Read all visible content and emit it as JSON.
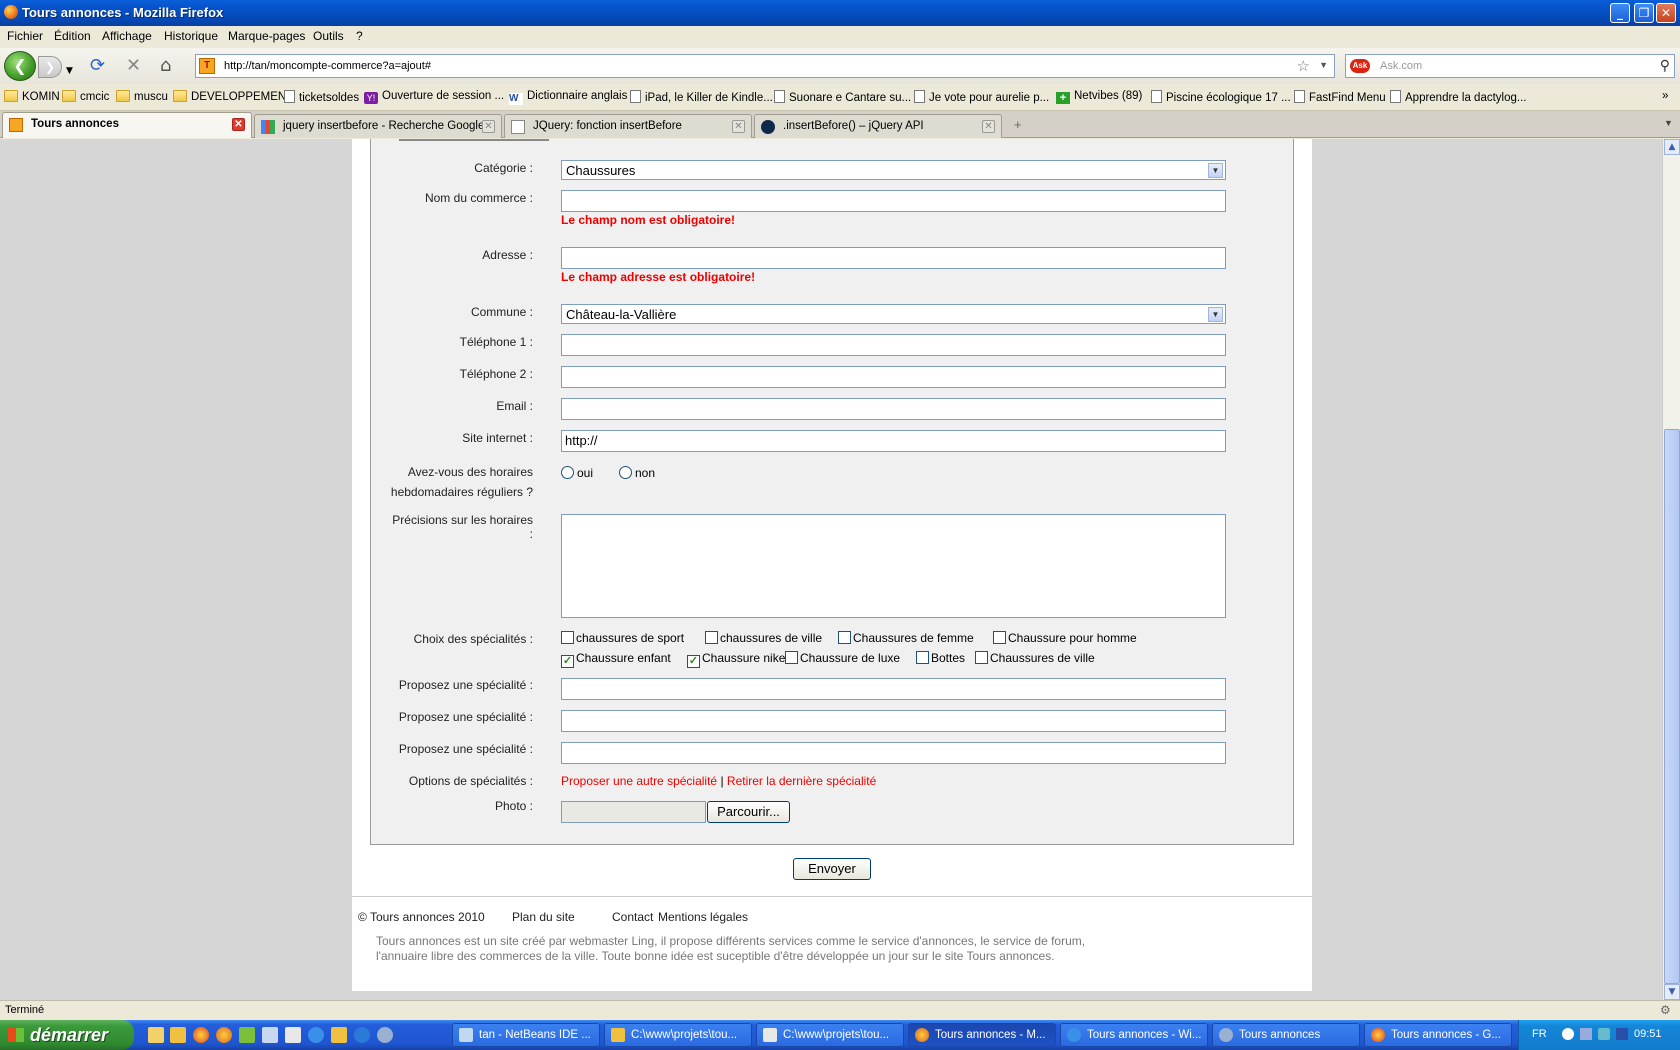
{
  "window": {
    "title": "Tours annonces - Mozilla Firefox"
  },
  "menu": [
    "Fichier",
    "Édition",
    "Affichage",
    "Historique",
    "Marque-pages",
    "Outils",
    "?"
  ],
  "nav": {
    "url": "http://tan/moncompte-commerce?a=ajout#",
    "search_placeholder": "Ask.com"
  },
  "bookmarks": [
    {
      "label": "KOMIN",
      "icon": "folder-icon"
    },
    {
      "label": "cmcic",
      "icon": "folder-icon"
    },
    {
      "label": "muscu",
      "icon": "folder-icon"
    },
    {
      "label": "DEVELOPPEMENT",
      "icon": "folder-icon"
    },
    {
      "label": "ticketsoldes",
      "icon": "page-icon"
    },
    {
      "label": "Ouverture de session ...",
      "icon": "yahoo-icon"
    },
    {
      "label": "Dictionnaire anglais",
      "icon": "wr-icon"
    },
    {
      "label": "iPad, le Killer de Kindle...",
      "icon": "page-icon"
    },
    {
      "label": "Suonare e Cantare su...",
      "icon": "page-icon"
    },
    {
      "label": "Je vote pour aurelie p...",
      "icon": "page-icon"
    },
    {
      "label": "Netvibes (89)",
      "icon": "plus-icon"
    },
    {
      "label": "Piscine écologique 17 ...",
      "icon": "page-icon"
    },
    {
      "label": "FastFind Menu",
      "icon": "page-icon"
    },
    {
      "label": "Apprendre la dactylog...",
      "icon": "page-icon"
    }
  ],
  "tabs": [
    {
      "label": "Tours annonces"
    },
    {
      "label": "jquery insertbefore - Recherche Google"
    },
    {
      "label": "JQuery: fonction insertBefore"
    },
    {
      "label": ".insertBefore() – jQuery API"
    }
  ],
  "form": {
    "categorie_label": "Catégorie :",
    "categorie_value": "Chaussures",
    "nom_label": "Nom du commerce :",
    "nom_error": "Le champ nom est obligatoire!",
    "adresse_label": "Adresse :",
    "adresse_error": "Le champ adresse est obligatoire!",
    "commune_label": "Commune :",
    "commune_value": "Château-la-Vallière",
    "tel1_label": "Téléphone 1 :",
    "tel2_label": "Téléphone 2 :",
    "email_label": "Email :",
    "site_label": "Site internet :",
    "site_value": "http://",
    "horaires_label_1": "Avez-vous des horaires",
    "horaires_label_2": "hebdomadaires réguliers ?",
    "radio_oui": "oui",
    "radio_non": "non",
    "precisions_label_1": "Précisions sur les horaires",
    "precisions_label_2": ":",
    "specialites_label": "Choix des spécialités :",
    "specialites": [
      {
        "label": "chaussures de sport",
        "checked": false
      },
      {
        "label": "chaussures de ville",
        "checked": false
      },
      {
        "label": "Chaussures de femme",
        "checked": false
      },
      {
        "label": "Chaussure pour homme",
        "checked": false
      },
      {
        "label": "Chaussure enfant",
        "checked": true
      },
      {
        "label": "Chaussure nike",
        "checked": true
      },
      {
        "label": "Chaussure de luxe",
        "checked": false
      },
      {
        "label": "Bottes",
        "checked": false
      },
      {
        "label": "Chaussures de ville",
        "checked": false
      }
    ],
    "propose_label": "Proposez une spécialité :",
    "options_label": "Options de spécialités :",
    "option_add": "Proposer une autre spécialité",
    "option_sep": "|",
    "option_remove": "Retirer la dernière spécialité",
    "photo_label": "Photo :",
    "browse_button": "Parcourir...",
    "submit_button": "Envoyer"
  },
  "footer": {
    "copyright": "© Tours annonces 2010",
    "links": [
      "Plan du site",
      "Contact",
      "Mentions légales"
    ],
    "description": "Tours annonces est un site créé par webmaster Ling, il propose différents services comme le service d'annonces, le service de forum, l'annuaire libre des commerces de la ville. Toute bonne idée est suceptible d'être développée un jour sur le site Tours annonces."
  },
  "status": {
    "text": "Terminé"
  },
  "taskbar": {
    "start": "démarrer",
    "items": [
      {
        "label": "tan - NetBeans IDE ..."
      },
      {
        "label": "C:\\www\\projets\\tou..."
      },
      {
        "label": "C:\\www\\projets\\tou..."
      },
      {
        "label": "Tours annonces - M..."
      },
      {
        "label": "Tours annonces - Wi..."
      },
      {
        "label": "Tours annonces"
      },
      {
        "label": "Tours annonces - G..."
      }
    ],
    "lang": "FR",
    "clock": "09:51"
  }
}
